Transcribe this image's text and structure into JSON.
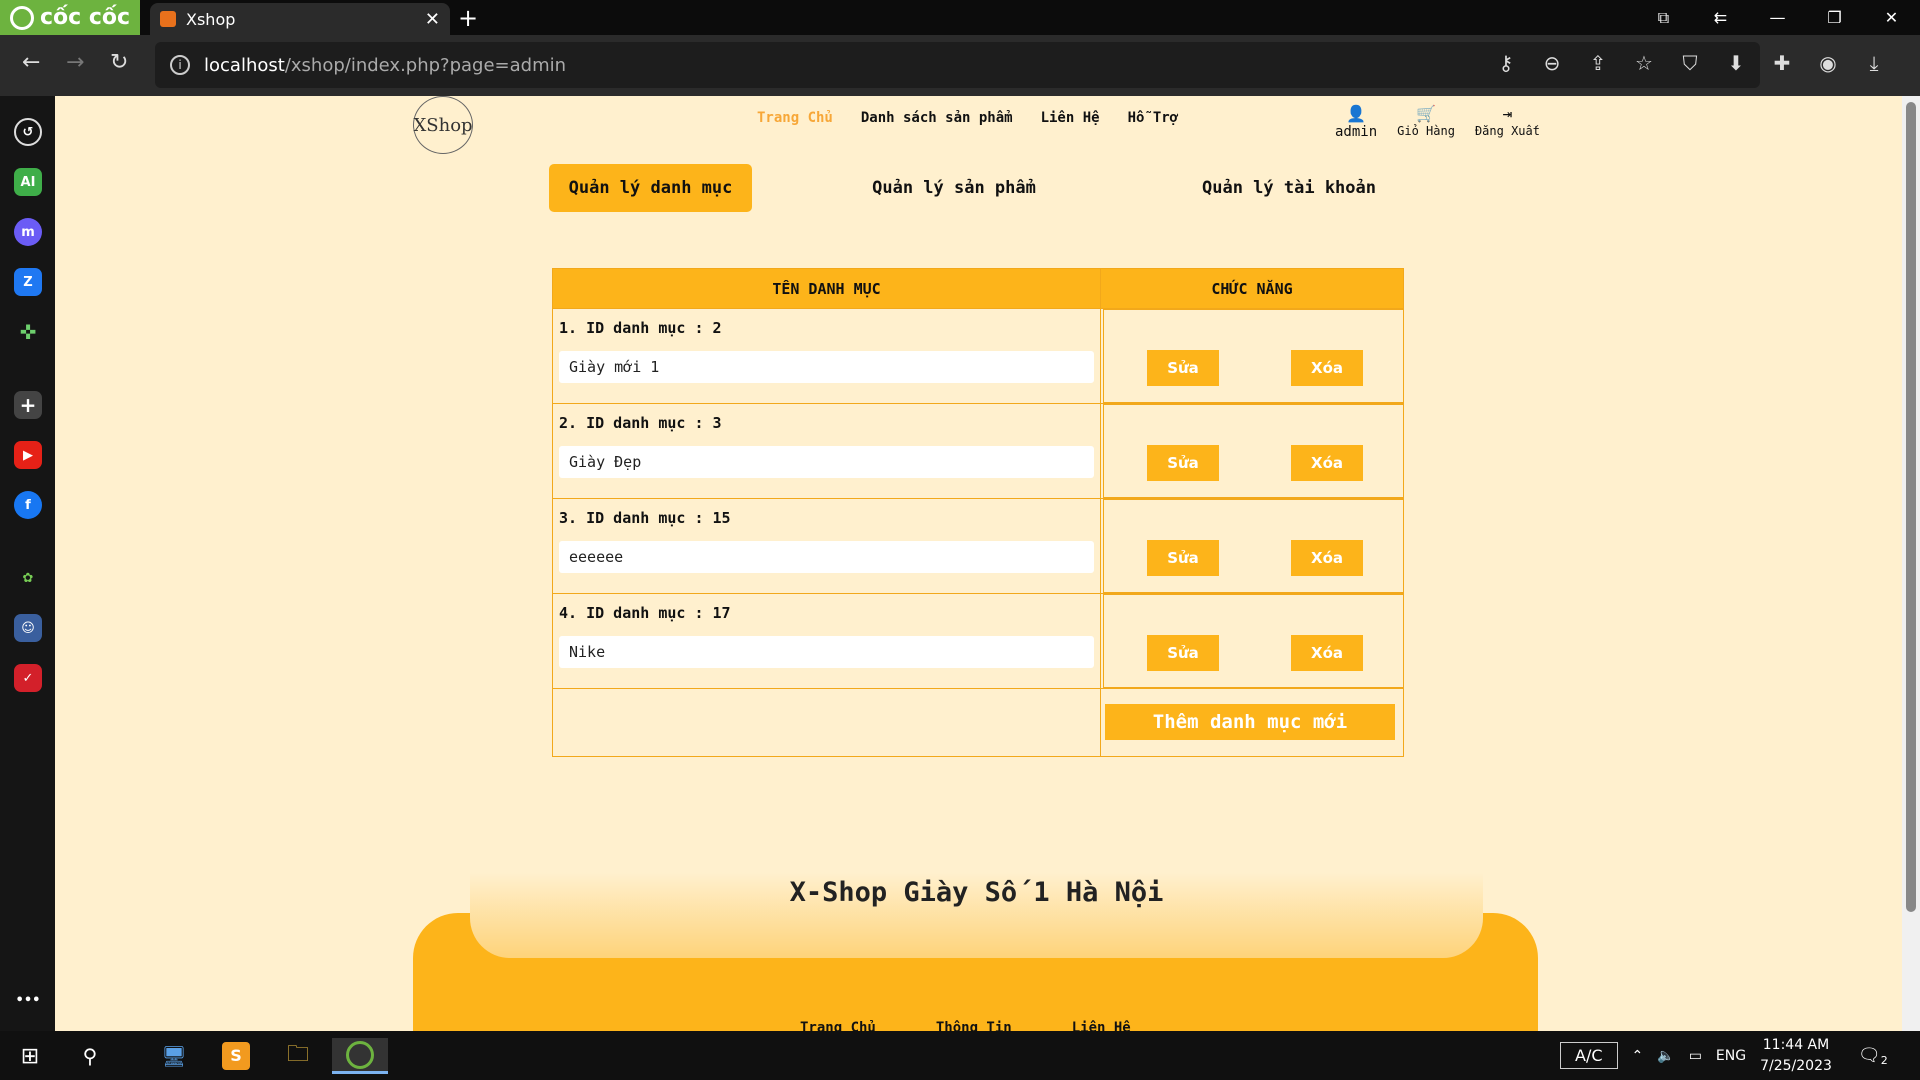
{
  "browser": {
    "brand": "cốc cốc",
    "tab_title": "Xshop",
    "url_host": "localhost",
    "url_path": "/xshop/index.php?page=admin"
  },
  "site": {
    "logo_text": "XShop",
    "nav": [
      "Trang Chủ",
      "Danh sách sản phẩm",
      "Liên Hệ",
      "Hỗ Trợ"
    ],
    "user": {
      "name": "admin",
      "cart": "Giỏ Hàng",
      "logout": "Đăng Xuất"
    }
  },
  "admin_tabs": [
    "Quản lý danh mục",
    "Quản lý sản phẩm",
    "Quản lý tài khoản"
  ],
  "table": {
    "header_name": "TÊN DANH MỤC",
    "header_actions": "CHỨC NĂNG",
    "rows": [
      {
        "label": "1. ID danh mục : 2",
        "value": "Giày mới 1"
      },
      {
        "label": "2. ID danh mục : 3",
        "value": "Giày Đẹp"
      },
      {
        "label": "3. ID danh mục : 15",
        "value": "eeeeee"
      },
      {
        "label": "4. ID danh mục : 17",
        "value": "Nike"
      }
    ],
    "edit_label": "Sửa",
    "delete_label": "Xóa",
    "add_label": "Thêm danh mục mới"
  },
  "footer": {
    "slogan": "X-Shop Giày Số 1 Hà Nội",
    "links": [
      "Trang Chủ",
      "Thông Tin",
      "Liên Hệ"
    ]
  },
  "taskbar": {
    "ac": "A/C",
    "lang": "ENG",
    "time": "11:44 AM",
    "date": "7/25/2023",
    "notifications": "2"
  },
  "colors": {
    "accent": "#fdb41a",
    "page_bg": "#fff0ce",
    "active_nav": "#f7a738"
  }
}
